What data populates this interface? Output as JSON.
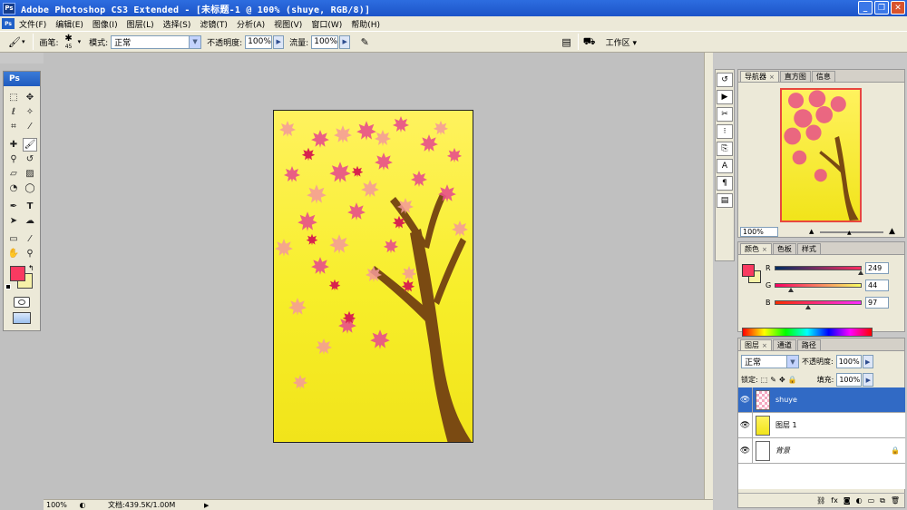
{
  "window": {
    "ps_badge": "Ps",
    "title": "Adobe Photoshop CS3 Extended - [未标题-1 @ 100% (shuye, RGB/8)]",
    "min": "_",
    "restore": "❐",
    "close": "✕"
  },
  "menu": [
    "文件(F)",
    "编辑(E)",
    "图像(I)",
    "图层(L)",
    "选择(S)",
    "滤镜(T)",
    "分析(A)",
    "视图(V)",
    "窗口(W)",
    "帮助(H)"
  ],
  "options": {
    "brush_label": "画笔:",
    "brush_size": "45",
    "mode_label": "模式:",
    "mode_value": "正常",
    "opacity_label": "不透明度:",
    "opacity_value": "100%",
    "flow_label": "流量:",
    "flow_value": "100%",
    "workspace_label": "工作区 ▾"
  },
  "toolbox": {
    "head": "Ps"
  },
  "status": {
    "zoom": "100%",
    "doc": "文档:439.5K/1.00M"
  },
  "navigator": {
    "tabs": [
      "导航器",
      "直方图",
      "信息"
    ],
    "zoom": "100%"
  },
  "color": {
    "tabs": [
      "颜色",
      "色板",
      "样式"
    ],
    "fg": "#f93a61",
    "bg": "#f6f1a8",
    "channels": [
      {
        "label": "R",
        "value": "249",
        "fraction": 0.976
      },
      {
        "label": "G",
        "value": "44",
        "fraction": 0.173
      },
      {
        "label": "B",
        "value": "97",
        "fraction": 0.38
      }
    ]
  },
  "layers": {
    "tabs": [
      "图层",
      "通道",
      "路径"
    ],
    "blend_mode": "正常",
    "opacity_label": "不透明度:",
    "opacity_value": "100%",
    "lock_label": "锁定:",
    "fill_label": "填充:",
    "fill_value": "100%",
    "items": [
      {
        "name": "shuye",
        "selected": true
      },
      {
        "name": "图层 1",
        "selected": false
      },
      {
        "name": "背景",
        "selected": false,
        "locked": true
      }
    ]
  }
}
